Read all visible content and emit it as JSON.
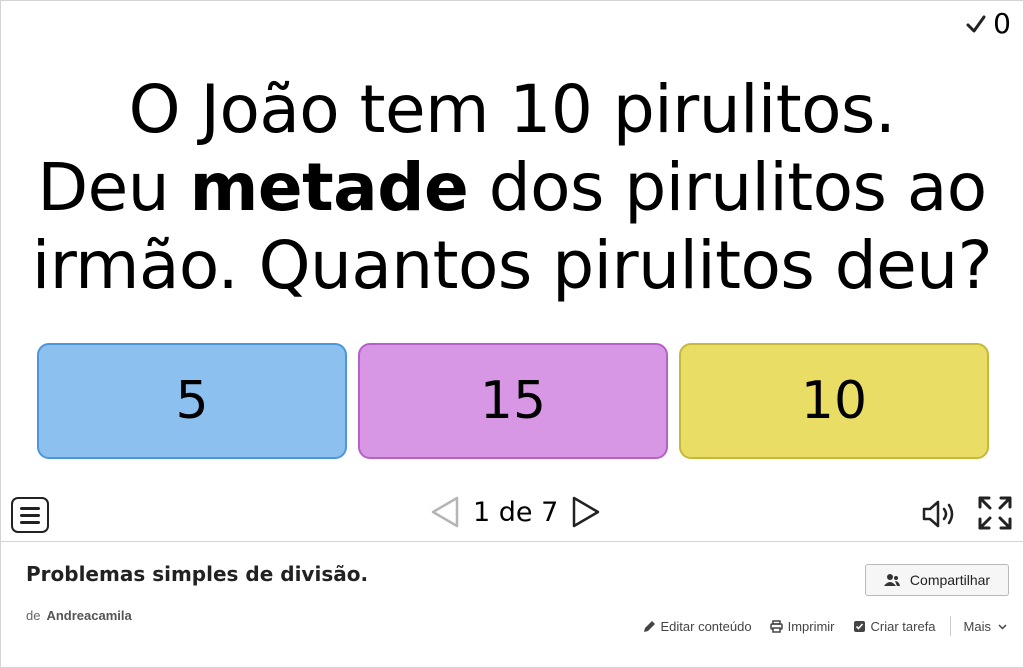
{
  "score": {
    "value": "0"
  },
  "question": {
    "line1": "O João tem 10 pirulitos.",
    "line2_before": "Deu ",
    "line2_bold": "metade",
    "line2_after": " dos pirulitos ao",
    "line3": "irmão. Quantos pirulitos deu?"
  },
  "answers": [
    {
      "label": "5",
      "bg": "#8cc1ef",
      "border": "#4d96d9"
    },
    {
      "label": "15",
      "bg": "#d897e4",
      "border": "#b760c8"
    },
    {
      "label": "10",
      "bg": "#e9dd66",
      "border": "#c5b83a"
    }
  ],
  "pager": {
    "label": "1 de 7"
  },
  "activity": {
    "title": "Problemas simples de divisão.",
    "author_prefix": "de",
    "author": "Andreacamila"
  },
  "buttons": {
    "share": "Compartilhar",
    "edit": "Editar conteúdo",
    "print": "Imprimir",
    "assign": "Criar tarefa",
    "more": "Mais"
  }
}
